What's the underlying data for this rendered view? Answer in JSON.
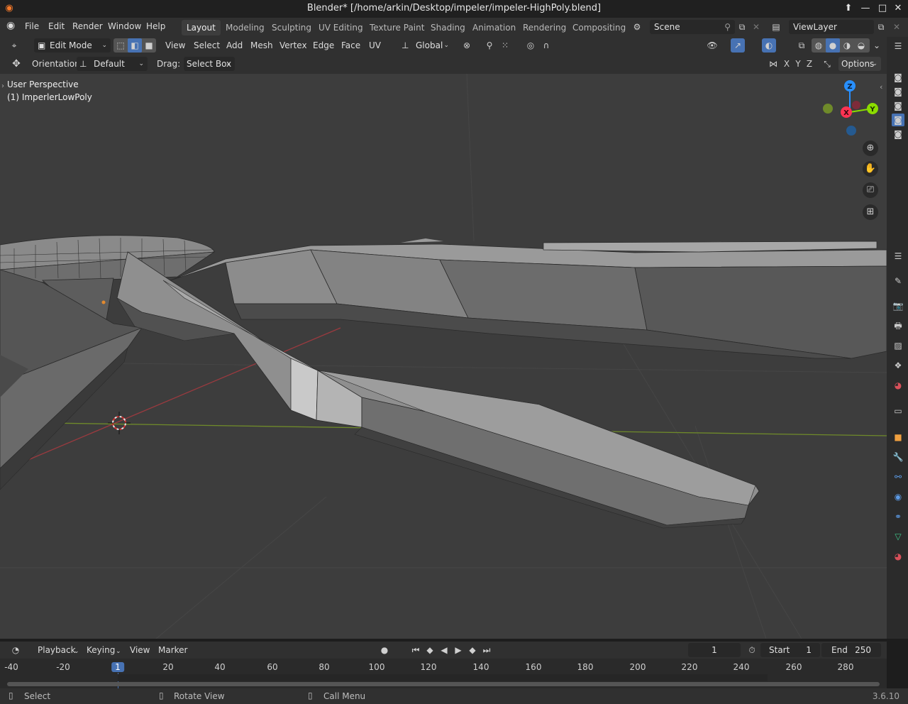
{
  "window": {
    "title": "Blender* [/home/arkin/Desktop/impeler/impeler-HighPoly.blend]"
  },
  "menu": [
    "File",
    "Edit",
    "Render",
    "Window",
    "Help"
  ],
  "workspaces": [
    "Layout",
    "Modeling",
    "Sculpting",
    "UV Editing",
    "Texture Paint",
    "Shading",
    "Animation",
    "Rendering",
    "Compositing"
  ],
  "active_workspace": "Layout",
  "scene": {
    "name": "Scene",
    "view_layer": "ViewLayer"
  },
  "header3d": {
    "mode": "Edit Mode",
    "menus": [
      "View",
      "Select",
      "Add",
      "Mesh",
      "Vertex",
      "Edge",
      "Face",
      "UV"
    ],
    "transform_orientation": "Global"
  },
  "toolsettings": {
    "orientation_label": "Orientation:",
    "orientation_value": "Default",
    "drag_label": "Drag:",
    "drag_value": "Select Box",
    "axes": [
      "X",
      "Y",
      "Z"
    ],
    "options": "Options"
  },
  "viewport": {
    "view_name": "User Perspective",
    "object_name": "(1) ImperlerLowPoly",
    "gizmo": {
      "z": "Z",
      "x": "X",
      "y": "Y"
    }
  },
  "timeline": {
    "menus": [
      "Playback",
      "Keying",
      "View",
      "Marker"
    ],
    "current_frame": "1",
    "start_label": "Start",
    "start": "1",
    "end_label": "End",
    "end": "250",
    "ruler": [
      "-40",
      "-20",
      "1",
      "20",
      "40",
      "60",
      "80",
      "100",
      "120",
      "140",
      "160",
      "180",
      "200",
      "220",
      "240",
      "260",
      "280"
    ]
  },
  "status": {
    "select": "Select",
    "rotate": "Rotate View",
    "call_menu": "Call Menu",
    "version": "3.6.10"
  },
  "colors": {
    "accent": "#4772b3",
    "viewport": "#3d3d3d",
    "x_axis": "#ff3352",
    "y_axis": "#8bdc00",
    "z_axis": "#2890ff"
  }
}
